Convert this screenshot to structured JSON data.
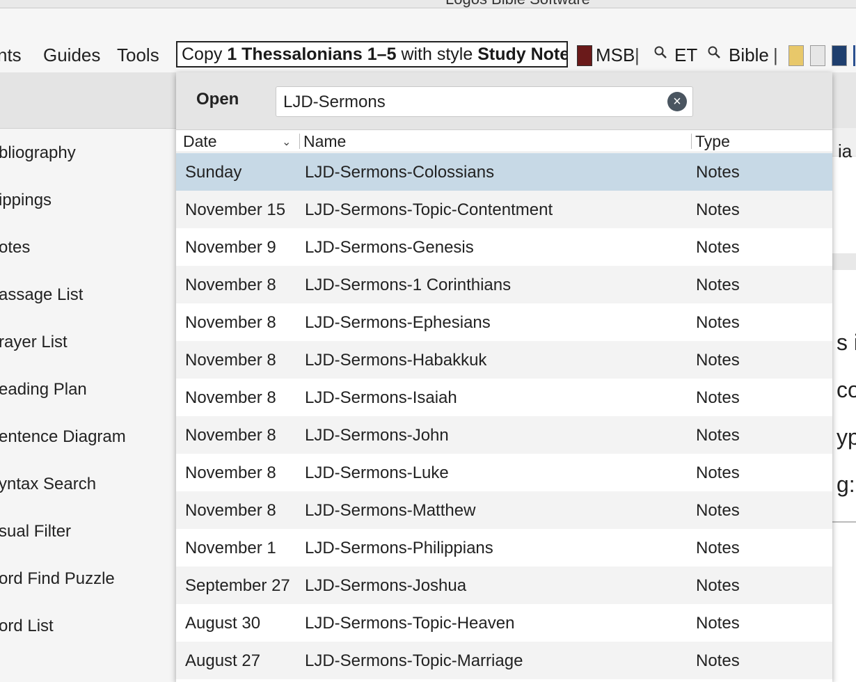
{
  "window": {
    "title_fragment": "Logos Bible Software"
  },
  "toolbar": {
    "menu": [
      "nts",
      "Guides",
      "Tools"
    ],
    "copy": {
      "prefix": "Copy ",
      "passage": "1 Thessalonians 1–5",
      "middle": " with style ",
      "style": "Study Notes"
    },
    "msb_label": "MSB",
    "sep": "|",
    "et_label": "ET",
    "bible_label": "Bible"
  },
  "sidebar": {
    "items": [
      "bliography",
      "ippings",
      "otes",
      "assage List",
      "rayer List",
      "eading Plan",
      "entence Diagram",
      "yntax Search",
      "sual Filter",
      "ord Find Puzzle",
      "ord List"
    ]
  },
  "background_right": {
    "header_frag": "ia",
    "lines": [
      "s ir",
      "co",
      "ype",
      "g:"
    ]
  },
  "open_dialog": {
    "label": "Open",
    "search_value": "LJD-Sermons",
    "clear_icon": "×",
    "columns": {
      "date": "Date",
      "name": "Name",
      "type": "Type"
    },
    "sort_indicator": "⌄",
    "rows": [
      {
        "date": "Sunday",
        "name": "LJD-Sermons-Colossians",
        "type": "Notes"
      },
      {
        "date": "November 15",
        "name": "LJD-Sermons-Topic-Contentment",
        "type": "Notes"
      },
      {
        "date": "November 9",
        "name": "LJD-Sermons-Genesis",
        "type": "Notes"
      },
      {
        "date": "November 8",
        "name": "LJD-Sermons-1 Corinthians",
        "type": "Notes"
      },
      {
        "date": "November 8",
        "name": "LJD-Sermons-Ephesians",
        "type": "Notes"
      },
      {
        "date": "November 8",
        "name": "LJD-Sermons-Habakkuk",
        "type": "Notes"
      },
      {
        "date": "November 8",
        "name": "LJD-Sermons-Isaiah",
        "type": "Notes"
      },
      {
        "date": "November 8",
        "name": "LJD-Sermons-John",
        "type": "Notes"
      },
      {
        "date": "November 8",
        "name": "LJD-Sermons-Luke",
        "type": "Notes"
      },
      {
        "date": "November 8",
        "name": "LJD-Sermons-Matthew",
        "type": "Notes"
      },
      {
        "date": "November 1",
        "name": "LJD-Sermons-Philippians",
        "type": "Notes"
      },
      {
        "date": "September 27",
        "name": "LJD-Sermons-Joshua",
        "type": "Notes"
      },
      {
        "date": "August 30",
        "name": "LJD-Sermons-Topic-Heaven",
        "type": "Notes"
      },
      {
        "date": "August 27",
        "name": "LJD-Sermons-Topic-Marriage",
        "type": "Notes"
      }
    ]
  },
  "colors": {
    "selected_row": "#c7d9e6",
    "alt_row": "#f3f3f3",
    "header_bg": "#e5e5e5"
  }
}
